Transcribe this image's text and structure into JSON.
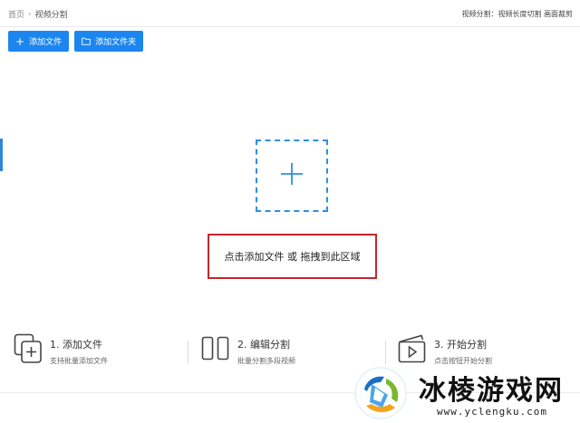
{
  "breadcrumb": {
    "home": "首页",
    "separator": "›",
    "current": "视频分割"
  },
  "header": {
    "hint": "视频分割：视频长度切割 画面裁剪"
  },
  "toolbar": {
    "add_file": "添加文件",
    "add_folder": "添加文件夹"
  },
  "dropzone": {
    "text": "点击添加文件 或 拖拽到此区域"
  },
  "steps": [
    {
      "title": "1. 添加文件",
      "desc": "支持批量添加文件",
      "icon": "copy-add-icon"
    },
    {
      "title": "2. 编辑分割",
      "desc": "批量分割多段视频",
      "icon": "split-icon"
    },
    {
      "title": "3. 开始分割",
      "desc": "点击按钮开始分割",
      "icon": "play-clapper-icon"
    }
  ],
  "watermark": {
    "brand": "冰棱游戏网",
    "url": "www.yclengku.com"
  },
  "colors": {
    "accent": "#1c86f0",
    "highlight_border": "#c8242a",
    "dashed": "#2d8ee8"
  }
}
